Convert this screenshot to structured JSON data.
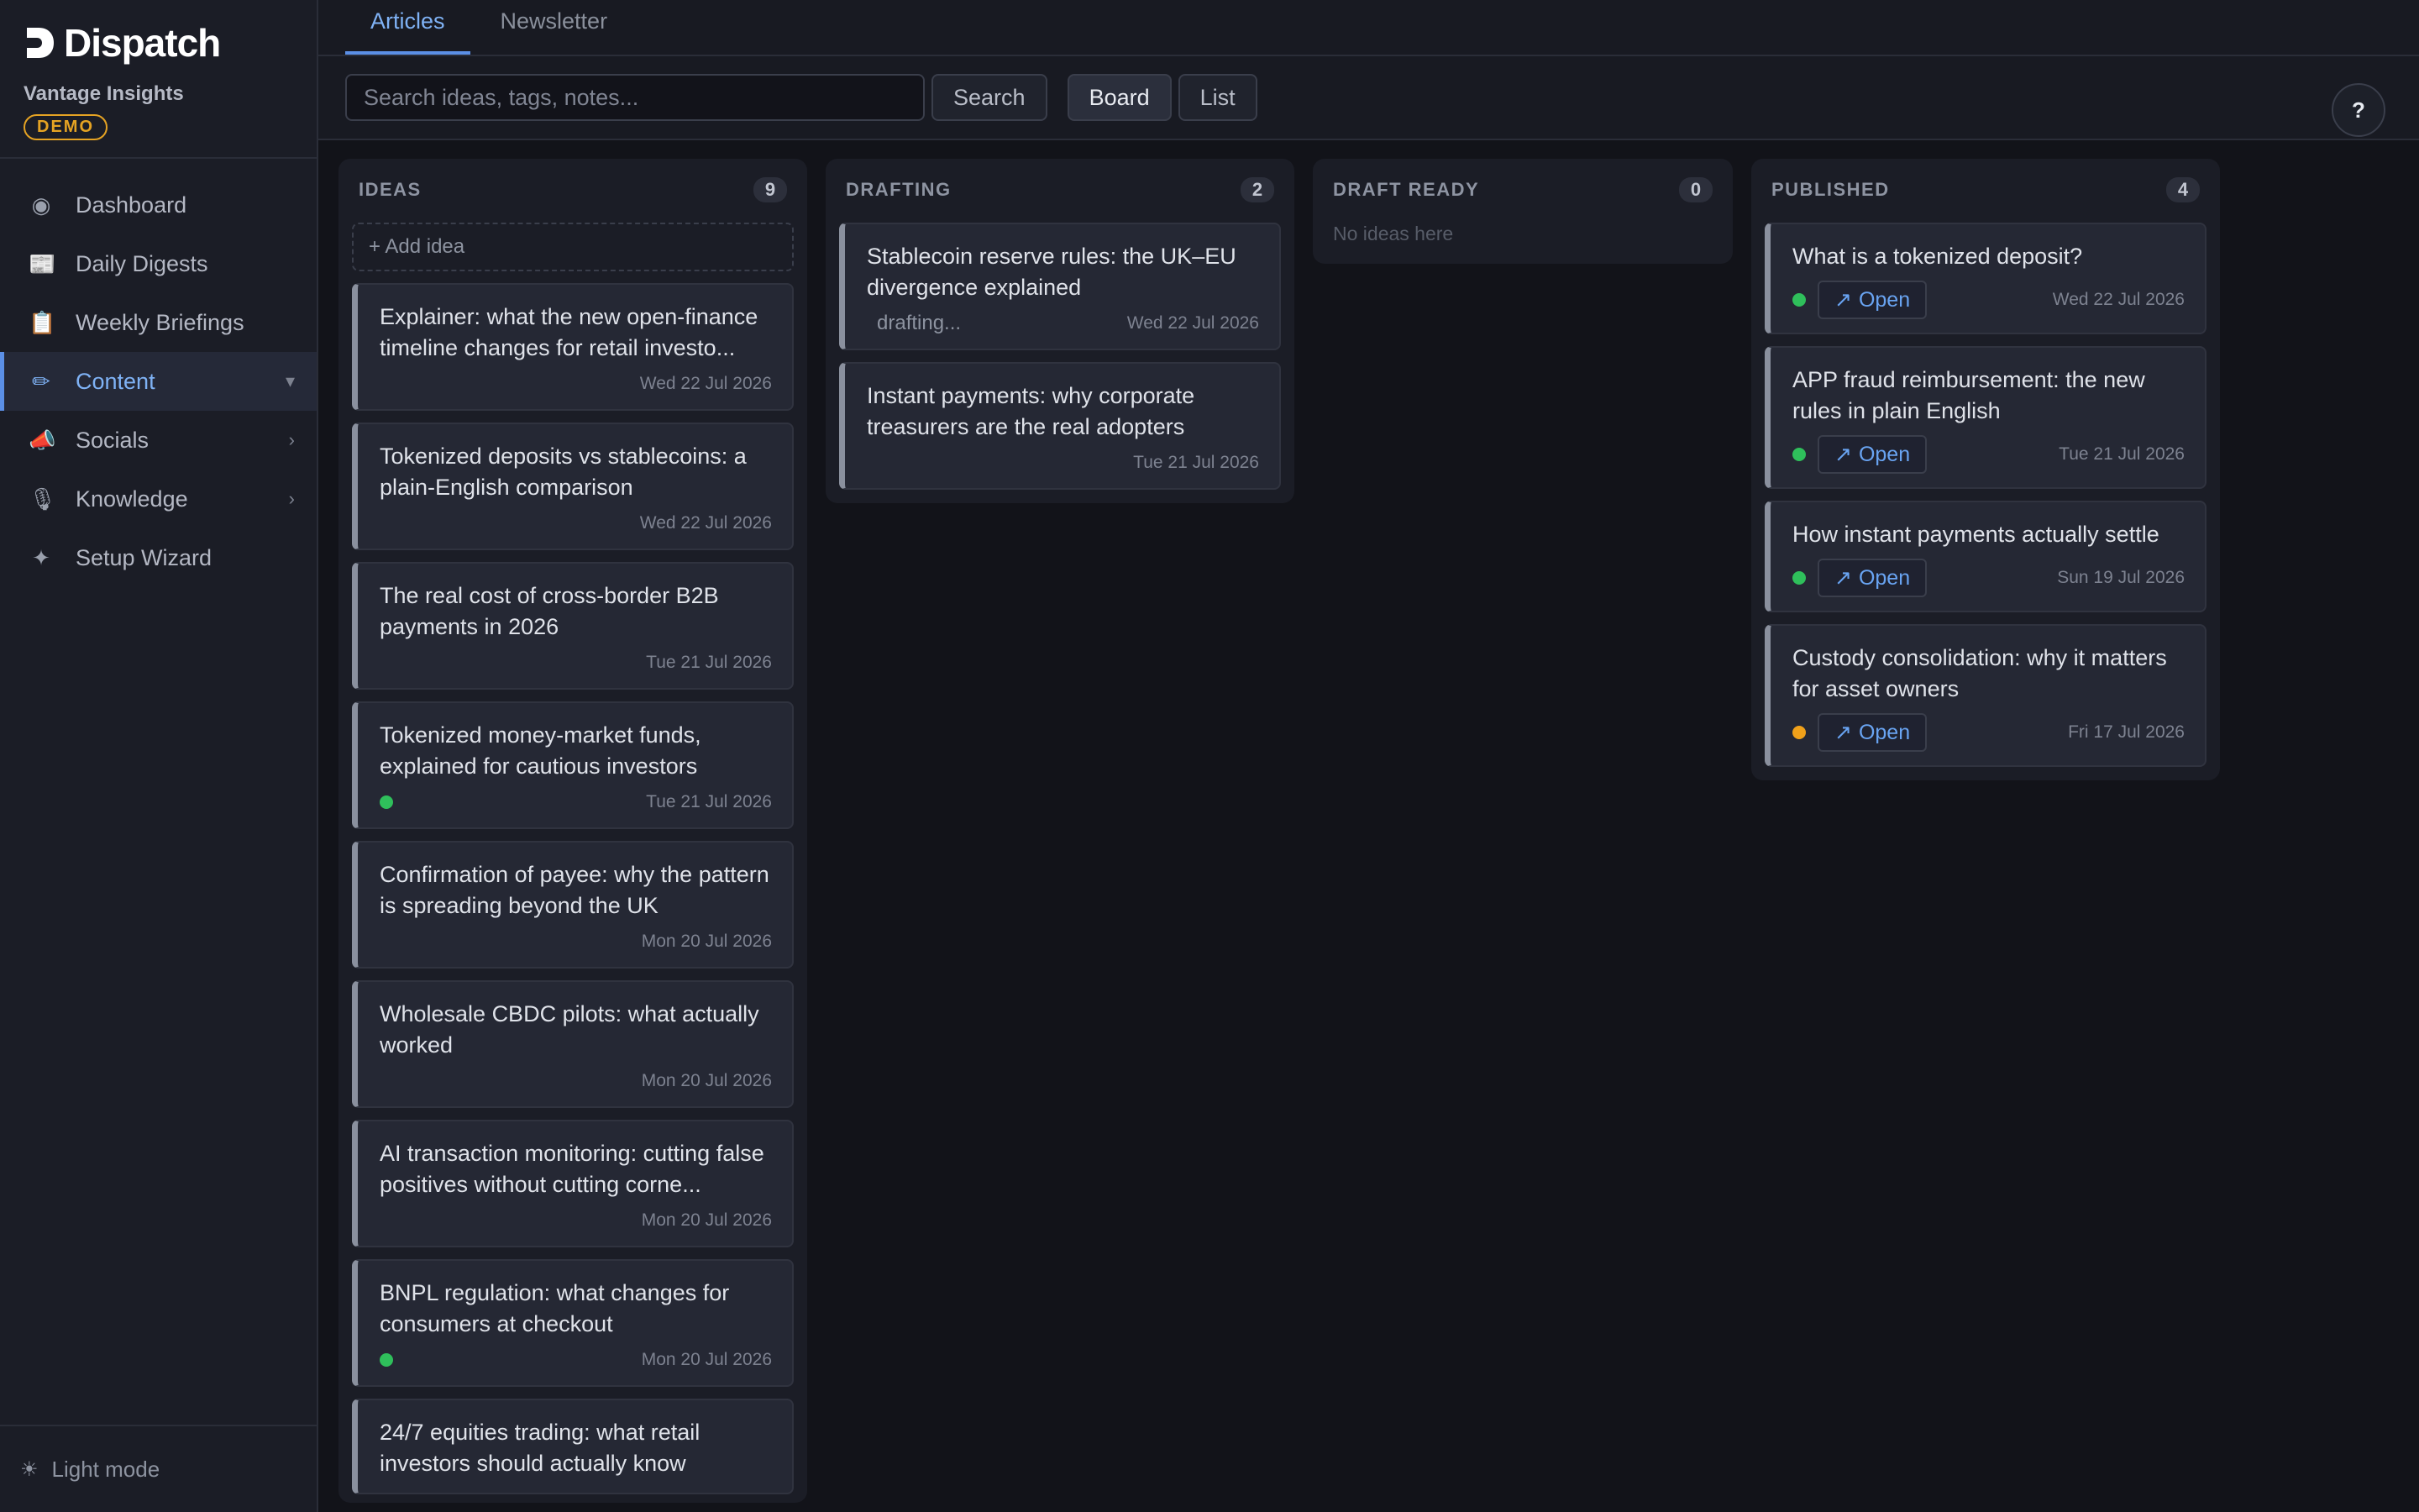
{
  "brand": {
    "name": "Dispatch",
    "org": "Vantage Insights",
    "badge": "DEMO"
  },
  "nav": {
    "items": [
      {
        "icon": "◉",
        "label": "Dashboard",
        "chev": ""
      },
      {
        "icon": "📰",
        "label": "Daily Digests",
        "chev": ""
      },
      {
        "icon": "📋",
        "label": "Weekly Briefings",
        "chev": ""
      },
      {
        "icon": "✏",
        "label": "Content",
        "chev": "▾"
      },
      {
        "icon": "📣",
        "label": "Socials",
        "chev": "›"
      },
      {
        "icon": "🎙",
        "label": "Knowledge",
        "chev": "›"
      },
      {
        "icon": "✦",
        "label": "Setup Wizard",
        "chev": ""
      }
    ],
    "active_index": 3
  },
  "footer": {
    "icon": "☀",
    "label": "Light mode"
  },
  "tabs": [
    "Articles",
    "Newsletter"
  ],
  "toolbar": {
    "search_placeholder": "Search ideas, tags, notes...",
    "search_label": "Search",
    "board_label": "Board",
    "list_label": "List",
    "help_label": "?"
  },
  "columns": {
    "ideas": {
      "title": "IDEAS",
      "count": "9",
      "add_label": "+ Add idea",
      "cards": [
        {
          "title": "Explainer: what the new open-finance timeline changes for retail investo...",
          "date": "Wed 22 Jul 2026",
          "dot": ""
        },
        {
          "title": "Tokenized deposits vs stablecoins: a plain-English comparison",
          "date": "Wed 22 Jul 2026",
          "dot": ""
        },
        {
          "title": "The real cost of cross-border B2B payments in 2026",
          "date": "Tue 21 Jul 2026",
          "dot": ""
        },
        {
          "title": "Tokenized money-market funds, explained for cautious investors",
          "date": "Tue 21 Jul 2026",
          "dot": "green"
        },
        {
          "title": "Confirmation of payee: why the pattern is spreading beyond the UK",
          "date": "Mon 20 Jul 2026",
          "dot": ""
        },
        {
          "title": "Wholesale CBDC pilots: what actually worked",
          "date": "Mon 20 Jul 2026",
          "dot": ""
        },
        {
          "title": "AI transaction monitoring: cutting false positives without cutting corne...",
          "date": "Mon 20 Jul 2026",
          "dot": ""
        },
        {
          "title": "BNPL regulation: what changes for consumers at checkout",
          "date": "Mon 20 Jul 2026",
          "dot": "green"
        },
        {
          "title": "24/7 equities trading: what retail investors should actually know",
          "date": "",
          "dot": ""
        }
      ]
    },
    "drafting": {
      "title": "DRAFTING",
      "count": "2",
      "cards": [
        {
          "title": "Stablecoin reserve rules: the UK–EU divergence explained",
          "date": "Wed 22 Jul 2026",
          "status": "drafting..."
        },
        {
          "title": "Instant payments: why corporate treasurers are the real adopters",
          "date": "Tue 21 Jul 2026",
          "status": ""
        }
      ]
    },
    "draft_ready": {
      "title": "DRAFT READY",
      "count": "0",
      "empty": "No ideas here"
    },
    "published": {
      "title": "PUBLISHED",
      "count": "4",
      "open_label": "Open",
      "open_icon": "↗",
      "cards": [
        {
          "title": "What is a tokenized deposit?",
          "date": "Wed 22 Jul 2026",
          "dot": "green"
        },
        {
          "title": "APP fraud reimbursement: the new rules in plain English",
          "date": "Tue 21 Jul 2026",
          "dot": "green"
        },
        {
          "title": "How instant payments actually settle",
          "date": "Sun 19 Jul 2026",
          "dot": "green"
        },
        {
          "title": "Custody consolidation: why it matters for asset owners",
          "date": "Fri 17 Jul 2026",
          "dot": "amber"
        }
      ]
    }
  },
  "colors": {
    "accent": "#5b8fe6",
    "green": "#2fbf5b",
    "amber": "#f0a11a",
    "demo": "#e5a323"
  }
}
